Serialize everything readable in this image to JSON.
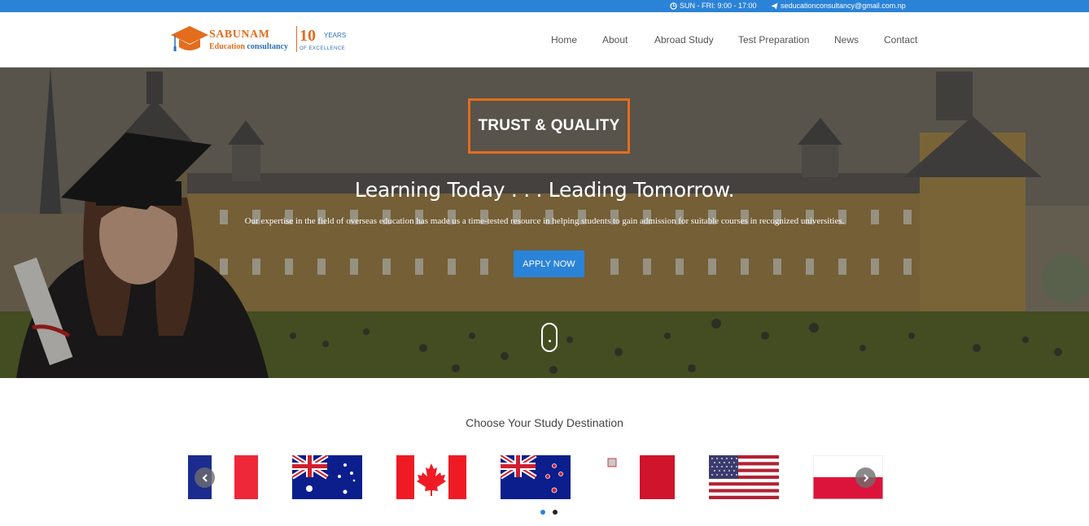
{
  "topbar": {
    "hours": "SUN - FRI: 9:00 - 17:00",
    "email": "seducationconsultancy@gmail.com.np"
  },
  "logo": {
    "name": "SABUNAM",
    "subtitle_part1": "Education",
    "subtitle_part2": "consultancy",
    "years_number": "10",
    "years_label": "YEARS",
    "tagline": "OF EXCELLENCE"
  },
  "nav": {
    "items": [
      {
        "label": "Home"
      },
      {
        "label": "About"
      },
      {
        "label": "Abroad Study"
      },
      {
        "label": "Test Preparation"
      },
      {
        "label": "News"
      },
      {
        "label": "Contact"
      }
    ]
  },
  "hero": {
    "badge": "TRUST & QUALITY",
    "title": "Learning Today . . . Leading Tomorrow.",
    "text": "Our expertise in the field of overseas education has made us a time-tested resource in helping students to gain admission for suitable courses in recognized universities.",
    "button": "APPLY NOW"
  },
  "destinations": {
    "title": "Choose Your Study Destination",
    "flags": [
      {
        "icon": "france-flag"
      },
      {
        "icon": "australia-flag"
      },
      {
        "icon": "canada-flag"
      },
      {
        "icon": "new-zealand-flag"
      },
      {
        "icon": "malta-flag"
      },
      {
        "icon": "usa-flag"
      },
      {
        "icon": "poland-flag"
      }
    ],
    "active_page": 1,
    "page_count": 2
  },
  "colors": {
    "accent_blue": "#2b83d8",
    "accent_orange": "#e36d1d"
  }
}
